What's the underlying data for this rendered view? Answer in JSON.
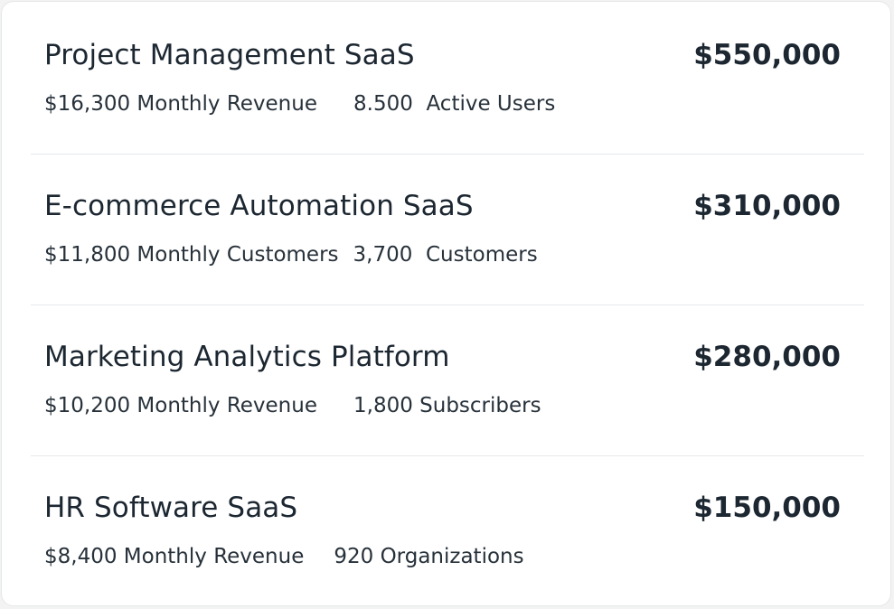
{
  "listings": [
    {
      "title": "Project Management SaaS",
      "price": "$550,000",
      "metric_primary": "$16,300 Monthly Revenue",
      "metric_secondary": "8.500  Active Users"
    },
    {
      "title": "E-commerce Automation SaaS",
      "price": "$310,000",
      "metric_primary": "$11,800 Monthly Customers",
      "metric_secondary": "3,700  Customers"
    },
    {
      "title": "Marketing Analytics Platform",
      "price": "$280,000",
      "metric_primary": "$10,200 Monthly Revenue",
      "metric_secondary": "1,800 Subscribers"
    },
    {
      "title": "HR Software SaaS",
      "price": "$150,000",
      "metric_primary": "$8,400 Monthly Revenue",
      "metric_secondary": "920 Organizations"
    }
  ]
}
